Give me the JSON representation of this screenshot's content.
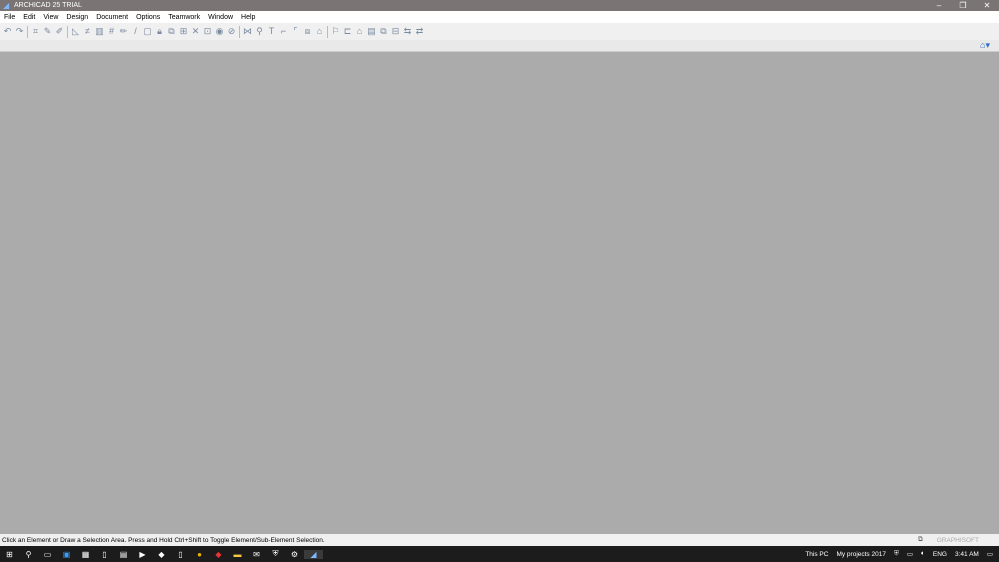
{
  "title": "ARCHICAD 25 TRIAL",
  "menu": [
    "File",
    "Edit",
    "View",
    "Design",
    "Document",
    "Options",
    "Teamwork",
    "Window",
    "Help"
  ],
  "status": {
    "message": "Click an Element or Draw a Selection Area. Press and Hold Ctrl+Shift to Toggle Element/Sub-Element Selection.",
    "brand": "GRAPHISOFT"
  },
  "taskbar": {
    "this_pc": "This PC",
    "folder": "My projects 2017",
    "lang": "ENG",
    "time": "3:41 AM"
  }
}
